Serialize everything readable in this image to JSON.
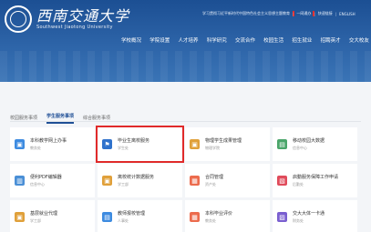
{
  "header": {
    "logo_cn": "西南交通大学",
    "logo_en": "Southwest Jiaotong University",
    "top_links": [
      "学习贯彻习近平新时代中国特色社会主义思想主题教育",
      "一网通办",
      "快速链接",
      "ENGLISH"
    ],
    "nav": [
      "学校概况",
      "学院设置",
      "人才培养",
      "科学研究",
      "交流合作",
      "校园生活",
      "招生就业",
      "招聘英才",
      "交大校友"
    ]
  },
  "tabs": [
    {
      "label": "校园服务事项",
      "active": false
    },
    {
      "label": "学生服务事项",
      "active": true
    },
    {
      "label": "综合服务事项",
      "active": false
    }
  ],
  "services": [
    {
      "title": "本科教学网上办事",
      "sub": "教务处",
      "icon": "folder-icon",
      "color": "#3d8be0",
      "glyph": "▣"
    },
    {
      "title": "毕业生离校服务",
      "sub": "学生处",
      "icon": "walking-person-icon",
      "color": "#2f72cc",
      "glyph": "⚑",
      "highlight": true
    },
    {
      "title": "物理学生成果管理",
      "sub": "物理学院",
      "icon": "folder-icon",
      "color": "#e0a03a",
      "glyph": "▣"
    },
    {
      "title": "移动校园大数据",
      "sub": "信息中心",
      "icon": "chart-icon",
      "color": "#4aa56a",
      "glyph": "▤"
    },
    {
      "title": "便利PDF编辑器",
      "sub": "信息中心",
      "icon": "document-icon",
      "color": "#4a8fd6",
      "glyph": "▥"
    },
    {
      "title": "离校统计数据服务",
      "sub": "学工部",
      "icon": "folder-icon",
      "color": "#e0a03a",
      "glyph": "▣"
    },
    {
      "title": "合同管理",
      "sub": "资产处",
      "icon": "contract-icon",
      "color": "#ec6b4d",
      "glyph": "▦"
    },
    {
      "title": "启動服务保障工作申请",
      "sub": "后勤处",
      "icon": "application-icon",
      "color": "#e04b5b",
      "glyph": "▧"
    },
    {
      "title": "基层就业代理",
      "sub": "学工部",
      "icon": "folder-icon",
      "color": "#e0a03a",
      "glyph": "▣"
    },
    {
      "title": "教师报校管理",
      "sub": "人事处",
      "icon": "book-icon",
      "color": "#3d8be0",
      "glyph": "▤"
    },
    {
      "title": "本科毕业评价",
      "sub": "教务处",
      "icon": "evaluation-icon",
      "color": "#ec6b4d",
      "glyph": "▦"
    },
    {
      "title": "交大大体一卡通",
      "sub": "财务处",
      "icon": "card-icon",
      "color": "#7a5fd0",
      "glyph": "▨"
    }
  ]
}
